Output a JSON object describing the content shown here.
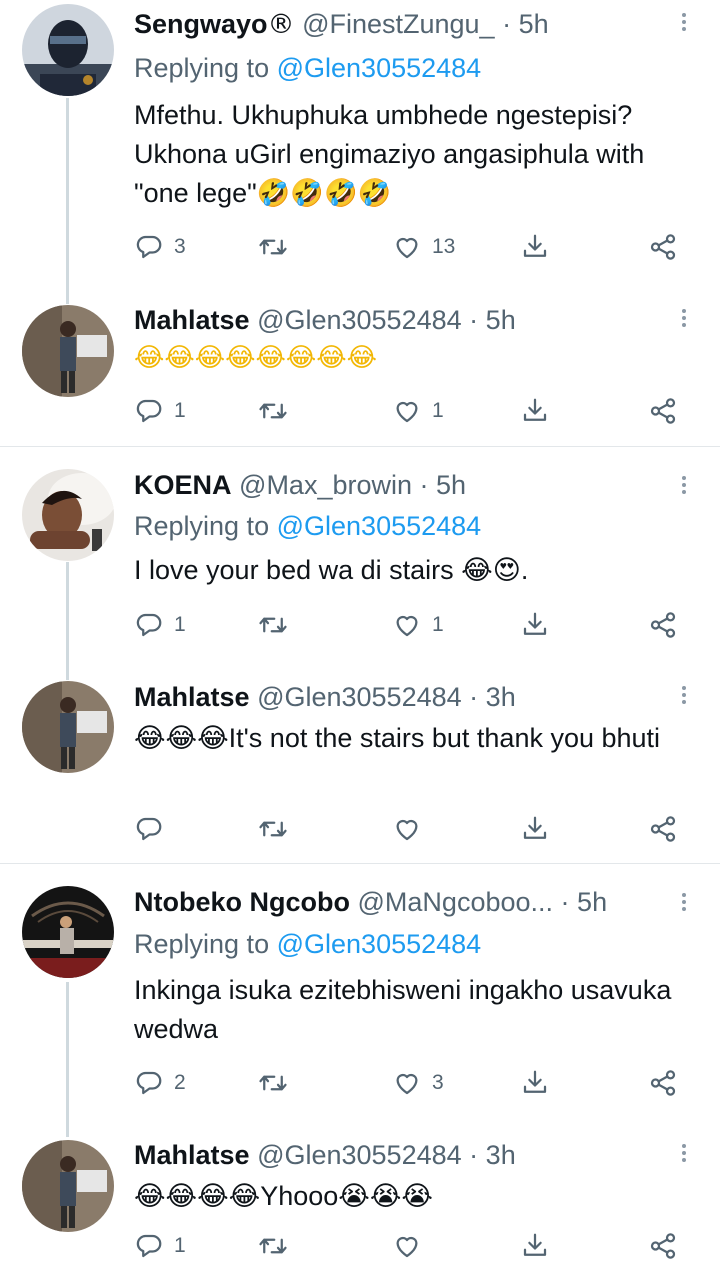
{
  "tweets": [
    {
      "name": "Sengwayo",
      "badge": "®",
      "handle": "@FinestZungu_",
      "dot": "·",
      "time": "5h",
      "replying_prefix": "Replying to",
      "replying_to": "@Glen30552484",
      "text": "Mfethu. Ukhuphuka umbhede ngestepisi? Ukhona uGirl engimaziyo angasiphula with \"one lege\"🤣🤣🤣🤣",
      "replies": "3",
      "retweets": "",
      "likes": "13"
    },
    {
      "name": "Mahlatse",
      "badge": "",
      "handle": "@Glen30552484",
      "dot": "·",
      "time": "5h",
      "replying_prefix": "",
      "replying_to": "",
      "text": "😂😂😂😂😂😂😂😂",
      "replies": "1",
      "retweets": "",
      "likes": "1"
    },
    {
      "name": "KOENA",
      "badge": "",
      "handle": "@Max_browin",
      "dot": "·",
      "time": "5h",
      "replying_prefix": "Replying to",
      "replying_to": "@Glen30552484",
      "text": "I love your bed wa di stairs 😂😍.",
      "replies": "1",
      "retweets": "",
      "likes": "1"
    },
    {
      "name": "Mahlatse",
      "badge": "",
      "handle": "@Glen30552484",
      "dot": "·",
      "time": "3h",
      "replying_prefix": "",
      "replying_to": "",
      "text": "😂😂😂It's not the stairs but thank you bhuti",
      "replies": "",
      "retweets": "",
      "likes": ""
    },
    {
      "name": "Ntobeko Ngcobo",
      "badge": "",
      "handle": "@MaNgcoboo...",
      "dot": "·",
      "time": "5h",
      "replying_prefix": "Replying to",
      "replying_to": "@Glen30552484",
      "text": "Inkinga isuka ezitebhisweni ingakho usavuka wedwa",
      "replies": "2",
      "retweets": "",
      "likes": "3"
    },
    {
      "name": "Mahlatse",
      "badge": "",
      "handle": "@Glen30552484",
      "dot": "·",
      "time": "3h",
      "replying_prefix": "",
      "replying_to": "",
      "text": "😂😂😂😂Yhooo😭😭😭",
      "replies": "1",
      "retweets": "",
      "likes": ""
    }
  ],
  "icons": {
    "reply": "reply-icon",
    "retweet": "retweet-icon",
    "like": "like-icon",
    "bookmark": "download-icon",
    "share": "share-icon",
    "more": "more-icon"
  },
  "colors": {
    "link": "#1d9bf0",
    "muted": "#536471",
    "thread_line": "#cfd9de"
  }
}
